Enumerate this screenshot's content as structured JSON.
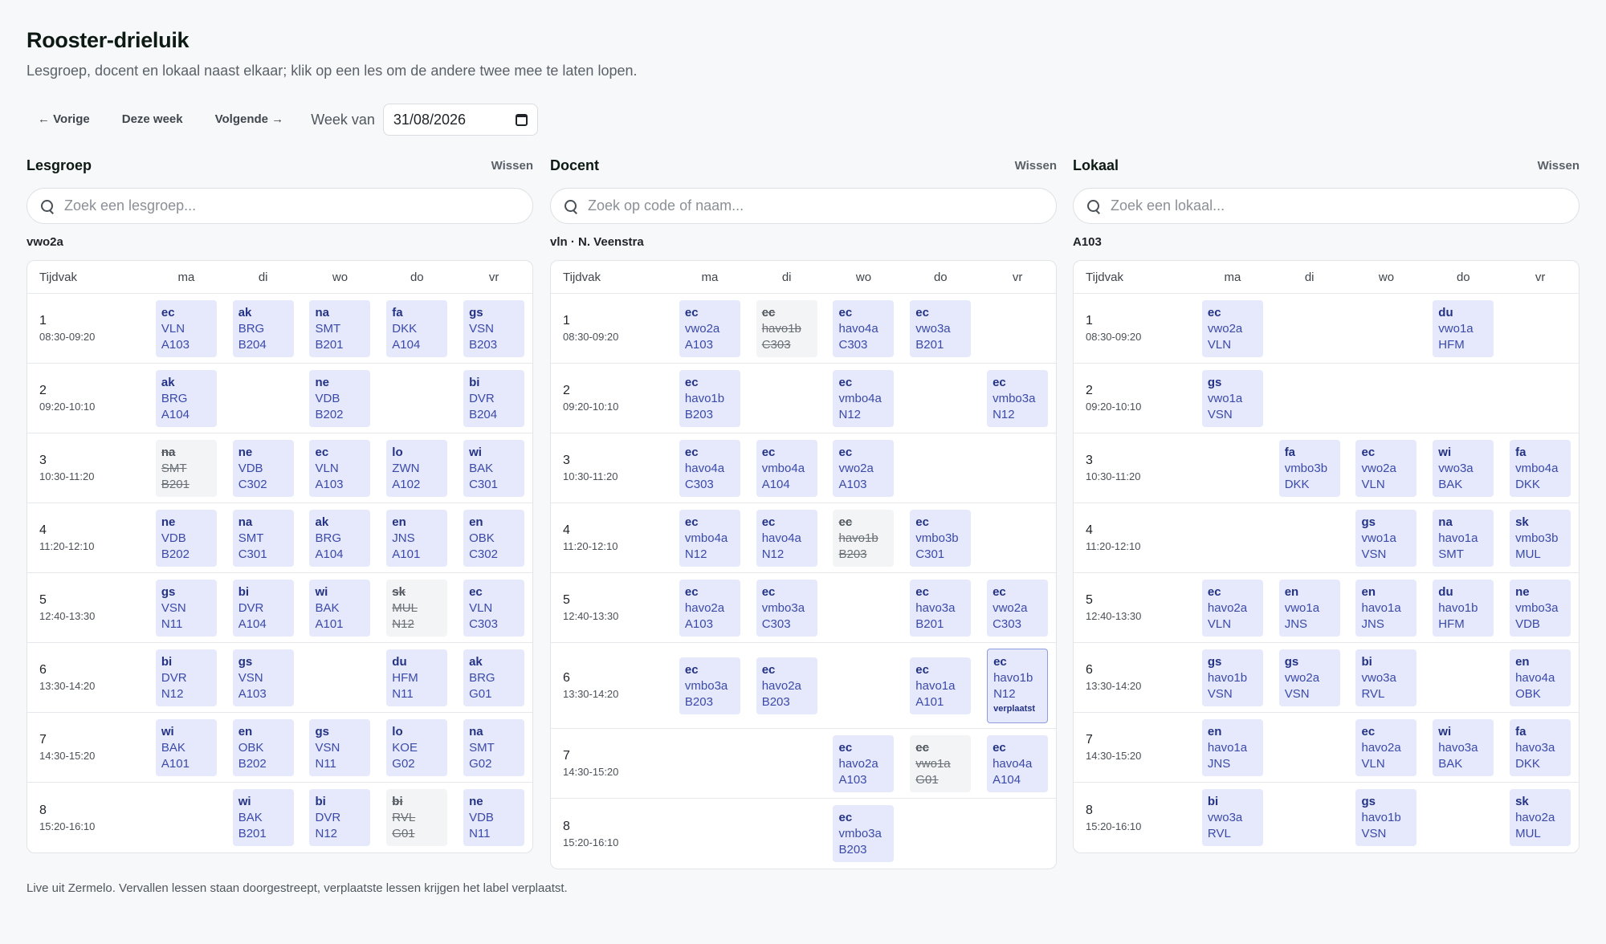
{
  "title": "Rooster-drieluik",
  "subtitle": "Lesgroep, docent en lokaal naast elkaar; klik op een les om de andere twee mee te laten lopen.",
  "toolbar": {
    "prev": "← Vorige",
    "this_week": "Deze week",
    "next": "Volgende →",
    "week_label": "Week van",
    "week_value": "31/08/2026"
  },
  "footer": "Live uit Zermelo. Vervallen lessen staan doorgestreept, verplaatste lessen krijgen het label verplaatst.",
  "header_cols": [
    "Tijdvak",
    "ma",
    "di",
    "wo",
    "do",
    "vr"
  ],
  "periods": [
    {
      "num": "1",
      "time": "08:30-09:20"
    },
    {
      "num": "2",
      "time": "09:20-10:10"
    },
    {
      "num": "3",
      "time": "10:30-11:20"
    },
    {
      "num": "4",
      "time": "11:20-12:10"
    },
    {
      "num": "5",
      "time": "12:40-13:30"
    },
    {
      "num": "6",
      "time": "13:30-14:20"
    },
    {
      "num": "7",
      "time": "14:30-15:20"
    },
    {
      "num": "8",
      "time": "15:20-16:10"
    }
  ],
  "panels": [
    {
      "key": "lesgroep",
      "title": "Lesgroep",
      "clear": "Wissen",
      "placeholder": "Zoek een lesgroep...",
      "selected": "vwo2a",
      "rows": [
        [
          [
            "ec",
            "VLN",
            "A103"
          ],
          [
            "ak",
            "BRG",
            "B204"
          ],
          [
            "na",
            "SMT",
            "B201"
          ],
          [
            "fa",
            "DKK",
            "A104"
          ],
          [
            "gs",
            "VSN",
            "B203"
          ]
        ],
        [
          [
            "ak",
            "BRG",
            "A104"
          ],
          null,
          [
            "ne",
            "VDB",
            "B202"
          ],
          null,
          [
            "bi",
            "DVR",
            "B204"
          ]
        ],
        [
          [
            "na",
            "SMT",
            "B201",
            "x"
          ],
          [
            "ne",
            "VDB",
            "C302"
          ],
          [
            "ec",
            "VLN",
            "A103"
          ],
          [
            "lo",
            "ZWN",
            "A102"
          ],
          [
            "wi",
            "BAK",
            "C301"
          ]
        ],
        [
          [
            "ne",
            "VDB",
            "B202"
          ],
          [
            "na",
            "SMT",
            "C301"
          ],
          [
            "ak",
            "BRG",
            "A104"
          ],
          [
            "en",
            "JNS",
            "A101"
          ],
          [
            "en",
            "OBK",
            "C302"
          ]
        ],
        [
          [
            "gs",
            "VSN",
            "N11"
          ],
          [
            "bi",
            "DVR",
            "A104"
          ],
          [
            "wi",
            "BAK",
            "A101"
          ],
          [
            "sk",
            "MUL",
            "N12",
            "x"
          ],
          [
            "ec",
            "VLN",
            "C303"
          ]
        ],
        [
          [
            "bi",
            "DVR",
            "N12"
          ],
          [
            "gs",
            "VSN",
            "A103"
          ],
          null,
          [
            "du",
            "HFM",
            "N11"
          ],
          [
            "ak",
            "BRG",
            "G01"
          ]
        ],
        [
          [
            "wi",
            "BAK",
            "A101"
          ],
          [
            "en",
            "OBK",
            "B202"
          ],
          [
            "gs",
            "VSN",
            "N11"
          ],
          [
            "lo",
            "KOE",
            "G02"
          ],
          [
            "na",
            "SMT",
            "G02"
          ]
        ],
        [
          null,
          [
            "wi",
            "BAK",
            "B201"
          ],
          [
            "bi",
            "DVR",
            "N12"
          ],
          [
            "bi",
            "RVL",
            "G01",
            "x"
          ],
          [
            "ne",
            "VDB",
            "N11"
          ]
        ]
      ]
    },
    {
      "key": "docent",
      "title": "Docent",
      "clear": "Wissen",
      "placeholder": "Zoek op code of naam...",
      "selected": "vln · N. Veenstra",
      "moved_label": "verplaatst",
      "rows": [
        [
          [
            "ec",
            "vwo2a",
            "A103"
          ],
          [
            "ec",
            "havo1b",
            "C303",
            "x"
          ],
          [
            "ec",
            "havo4a",
            "C303"
          ],
          [
            "ec",
            "vwo3a",
            "B201"
          ],
          null
        ],
        [
          [
            "ec",
            "havo1b",
            "B203"
          ],
          null,
          [
            "ec",
            "vmbo4a",
            "N12"
          ],
          null,
          [
            "ec",
            "vmbo3a",
            "N12"
          ]
        ],
        [
          [
            "ec",
            "havo4a",
            "C303"
          ],
          [
            "ec",
            "vmbo4a",
            "A104"
          ],
          [
            "ec",
            "vwo2a",
            "A103"
          ],
          null,
          null
        ],
        [
          [
            "ec",
            "vmbo4a",
            "N12"
          ],
          [
            "ec",
            "havo4a",
            "N12"
          ],
          [
            "ec",
            "havo1b",
            "B203",
            "x"
          ],
          [
            "ec",
            "vmbo3b",
            "C301"
          ],
          null
        ],
        [
          [
            "ec",
            "havo2a",
            "A103"
          ],
          [
            "ec",
            "vmbo3a",
            "C303"
          ],
          null,
          [
            "ec",
            "havo3a",
            "B201"
          ],
          [
            "ec",
            "vwo2a",
            "C303"
          ]
        ],
        [
          [
            "ec",
            "vmbo3a",
            "B203"
          ],
          [
            "ec",
            "havo2a",
            "B203"
          ],
          null,
          [
            "ec",
            "havo1a",
            "A101"
          ],
          [
            "ec",
            "havo1b",
            "N12",
            "m"
          ]
        ],
        [
          null,
          null,
          [
            "ec",
            "havo2a",
            "A103"
          ],
          [
            "ec",
            "vwo1a",
            "G01",
            "x"
          ],
          [
            "ec",
            "havo4a",
            "A104"
          ]
        ],
        [
          null,
          null,
          [
            "ec",
            "vmbo3a",
            "B203"
          ],
          null,
          null
        ]
      ]
    },
    {
      "key": "lokaal",
      "title": "Lokaal",
      "clear": "Wissen",
      "placeholder": "Zoek een lokaal...",
      "selected": "A103",
      "rows": [
        [
          [
            "ec",
            "vwo2a",
            "VLN"
          ],
          null,
          null,
          [
            "du",
            "vwo1a",
            "HFM"
          ],
          null
        ],
        [
          [
            "gs",
            "vwo1a",
            "VSN"
          ],
          null,
          null,
          null,
          null
        ],
        [
          null,
          [
            "fa",
            "vmbo3b",
            "DKK"
          ],
          [
            "ec",
            "vwo2a",
            "VLN"
          ],
          [
            "wi",
            "vwo3a",
            "BAK"
          ],
          [
            "fa",
            "vmbo4a",
            "DKK"
          ]
        ],
        [
          null,
          null,
          [
            "gs",
            "vwo1a",
            "VSN"
          ],
          [
            "na",
            "havo1a",
            "SMT"
          ],
          [
            "sk",
            "vmbo3b",
            "MUL"
          ]
        ],
        [
          [
            "ec",
            "havo2a",
            "VLN"
          ],
          [
            "en",
            "vwo1a",
            "JNS"
          ],
          [
            "en",
            "havo1a",
            "JNS"
          ],
          [
            "du",
            "havo1b",
            "HFM"
          ],
          [
            "ne",
            "vmbo3a",
            "VDB"
          ]
        ],
        [
          [
            "gs",
            "havo1b",
            "VSN"
          ],
          [
            "gs",
            "vwo2a",
            "VSN"
          ],
          [
            "bi",
            "vwo3a",
            "RVL"
          ],
          null,
          [
            "en",
            "havo4a",
            "OBK"
          ]
        ],
        [
          [
            "en",
            "havo1a",
            "JNS"
          ],
          null,
          [
            "ec",
            "havo2a",
            "VLN"
          ],
          [
            "wi",
            "havo3a",
            "BAK"
          ],
          [
            "fa",
            "havo3a",
            "DKK"
          ]
        ],
        [
          [
            "bi",
            "vwo3a",
            "RVL"
          ],
          null,
          [
            "gs",
            "havo1b",
            "VSN"
          ],
          null,
          [
            "sk",
            "havo2a",
            "MUL"
          ]
        ]
      ]
    }
  ]
}
